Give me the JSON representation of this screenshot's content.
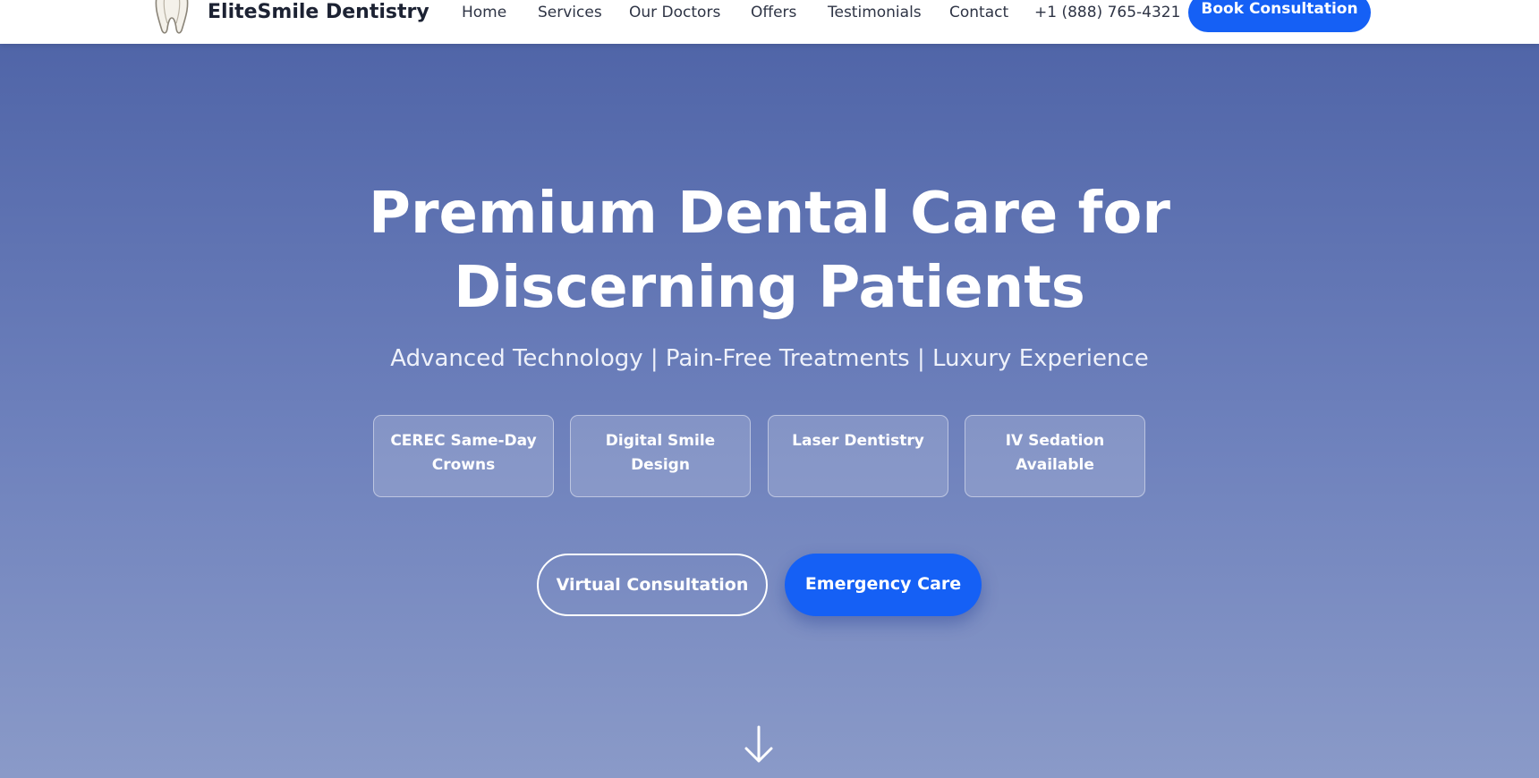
{
  "header": {
    "brand": "EliteSmile Dentistry",
    "nav": [
      "Home",
      "Services",
      "Our Doctors",
      "Offers",
      "Testimonials",
      "Contact"
    ],
    "phone": "+1 (888) 765-4321",
    "cta": "Book Consultation"
  },
  "hero": {
    "title_line1": "Premium Dental Care for",
    "title_line2": "Discerning Patients",
    "subtitle": "Advanced Technology | Pain-Free Treatments | Luxury Experience",
    "features": [
      [
        "CEREC Same-Day",
        "Crowns"
      ],
      [
        "Digital Smile",
        "Design"
      ],
      [
        "Laser Dentistry",
        ""
      ],
      [
        "IV Sedation",
        "Available"
      ]
    ],
    "primary_button": "Virtual Consultation",
    "secondary_button": "Emergency Care"
  },
  "icons": {
    "logo": "tooth-icon",
    "scroll": "arrow-down-icon"
  },
  "colors": {
    "accent": "#1560f5",
    "hero_top": "#5065a8",
    "hero_bottom": "#8a9ac8",
    "text_dark": "#1c2233"
  }
}
